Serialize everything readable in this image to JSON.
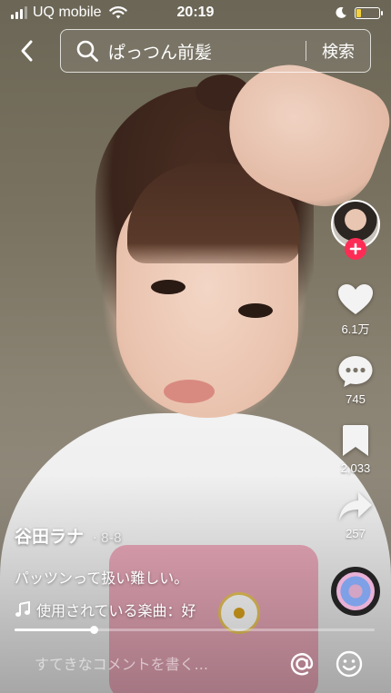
{
  "status_bar": {
    "carrier": "UQ mobile",
    "time": "20:19",
    "battery_level": 0.2,
    "battery_color": "#f4d23c"
  },
  "search": {
    "query": "ぱっつん前髪",
    "submit_label": "検索",
    "back_icon": "chevron-left-icon",
    "search_icon": "magnifier-icon"
  },
  "actions": {
    "follow_color": "#fe2c55",
    "likes": "6.1万",
    "comments": "745",
    "bookmarks": "2,033",
    "shares": "257"
  },
  "video": {
    "author": "谷田ラナ",
    "date": "· 8-8",
    "caption": "パッツンって扱い難しい。",
    "music": "使用されている楽曲：好",
    "progress": 0.22
  },
  "comment_bar": {
    "placeholder": "すてきなコメントを書く..."
  }
}
